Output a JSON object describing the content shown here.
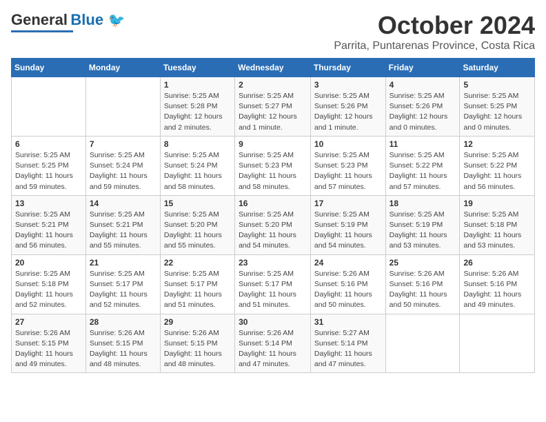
{
  "header": {
    "logo_line1": "General",
    "logo_line2": "Blue",
    "title": "October 2024",
    "subtitle": "Parrita, Puntarenas Province, Costa Rica"
  },
  "weekdays": [
    "Sunday",
    "Monday",
    "Tuesday",
    "Wednesday",
    "Thursday",
    "Friday",
    "Saturday"
  ],
  "weeks": [
    [
      {
        "day": "",
        "detail": ""
      },
      {
        "day": "",
        "detail": ""
      },
      {
        "day": "1",
        "detail": "Sunrise: 5:25 AM\nSunset: 5:28 PM\nDaylight: 12 hours\nand 2 minutes."
      },
      {
        "day": "2",
        "detail": "Sunrise: 5:25 AM\nSunset: 5:27 PM\nDaylight: 12 hours\nand 1 minute."
      },
      {
        "day": "3",
        "detail": "Sunrise: 5:25 AM\nSunset: 5:26 PM\nDaylight: 12 hours\nand 1 minute."
      },
      {
        "day": "4",
        "detail": "Sunrise: 5:25 AM\nSunset: 5:26 PM\nDaylight: 12 hours\nand 0 minutes."
      },
      {
        "day": "5",
        "detail": "Sunrise: 5:25 AM\nSunset: 5:25 PM\nDaylight: 12 hours\nand 0 minutes."
      }
    ],
    [
      {
        "day": "6",
        "detail": "Sunrise: 5:25 AM\nSunset: 5:25 PM\nDaylight: 11 hours\nand 59 minutes."
      },
      {
        "day": "7",
        "detail": "Sunrise: 5:25 AM\nSunset: 5:24 PM\nDaylight: 11 hours\nand 59 minutes."
      },
      {
        "day": "8",
        "detail": "Sunrise: 5:25 AM\nSunset: 5:24 PM\nDaylight: 11 hours\nand 58 minutes."
      },
      {
        "day": "9",
        "detail": "Sunrise: 5:25 AM\nSunset: 5:23 PM\nDaylight: 11 hours\nand 58 minutes."
      },
      {
        "day": "10",
        "detail": "Sunrise: 5:25 AM\nSunset: 5:23 PM\nDaylight: 11 hours\nand 57 minutes."
      },
      {
        "day": "11",
        "detail": "Sunrise: 5:25 AM\nSunset: 5:22 PM\nDaylight: 11 hours\nand 57 minutes."
      },
      {
        "day": "12",
        "detail": "Sunrise: 5:25 AM\nSunset: 5:22 PM\nDaylight: 11 hours\nand 56 minutes."
      }
    ],
    [
      {
        "day": "13",
        "detail": "Sunrise: 5:25 AM\nSunset: 5:21 PM\nDaylight: 11 hours\nand 56 minutes."
      },
      {
        "day": "14",
        "detail": "Sunrise: 5:25 AM\nSunset: 5:21 PM\nDaylight: 11 hours\nand 55 minutes."
      },
      {
        "day": "15",
        "detail": "Sunrise: 5:25 AM\nSunset: 5:20 PM\nDaylight: 11 hours\nand 55 minutes."
      },
      {
        "day": "16",
        "detail": "Sunrise: 5:25 AM\nSunset: 5:20 PM\nDaylight: 11 hours\nand 54 minutes."
      },
      {
        "day": "17",
        "detail": "Sunrise: 5:25 AM\nSunset: 5:19 PM\nDaylight: 11 hours\nand 54 minutes."
      },
      {
        "day": "18",
        "detail": "Sunrise: 5:25 AM\nSunset: 5:19 PM\nDaylight: 11 hours\nand 53 minutes."
      },
      {
        "day": "19",
        "detail": "Sunrise: 5:25 AM\nSunset: 5:18 PM\nDaylight: 11 hours\nand 53 minutes."
      }
    ],
    [
      {
        "day": "20",
        "detail": "Sunrise: 5:25 AM\nSunset: 5:18 PM\nDaylight: 11 hours\nand 52 minutes."
      },
      {
        "day": "21",
        "detail": "Sunrise: 5:25 AM\nSunset: 5:17 PM\nDaylight: 11 hours\nand 52 minutes."
      },
      {
        "day": "22",
        "detail": "Sunrise: 5:25 AM\nSunset: 5:17 PM\nDaylight: 11 hours\nand 51 minutes."
      },
      {
        "day": "23",
        "detail": "Sunrise: 5:25 AM\nSunset: 5:17 PM\nDaylight: 11 hours\nand 51 minutes."
      },
      {
        "day": "24",
        "detail": "Sunrise: 5:26 AM\nSunset: 5:16 PM\nDaylight: 11 hours\nand 50 minutes."
      },
      {
        "day": "25",
        "detail": "Sunrise: 5:26 AM\nSunset: 5:16 PM\nDaylight: 11 hours\nand 50 minutes."
      },
      {
        "day": "26",
        "detail": "Sunrise: 5:26 AM\nSunset: 5:16 PM\nDaylight: 11 hours\nand 49 minutes."
      }
    ],
    [
      {
        "day": "27",
        "detail": "Sunrise: 5:26 AM\nSunset: 5:15 PM\nDaylight: 11 hours\nand 49 minutes."
      },
      {
        "day": "28",
        "detail": "Sunrise: 5:26 AM\nSunset: 5:15 PM\nDaylight: 11 hours\nand 48 minutes."
      },
      {
        "day": "29",
        "detail": "Sunrise: 5:26 AM\nSunset: 5:15 PM\nDaylight: 11 hours\nand 48 minutes."
      },
      {
        "day": "30",
        "detail": "Sunrise: 5:26 AM\nSunset: 5:14 PM\nDaylight: 11 hours\nand 47 minutes."
      },
      {
        "day": "31",
        "detail": "Sunrise: 5:27 AM\nSunset: 5:14 PM\nDaylight: 11 hours\nand 47 minutes."
      },
      {
        "day": "",
        "detail": ""
      },
      {
        "day": "",
        "detail": ""
      }
    ]
  ]
}
